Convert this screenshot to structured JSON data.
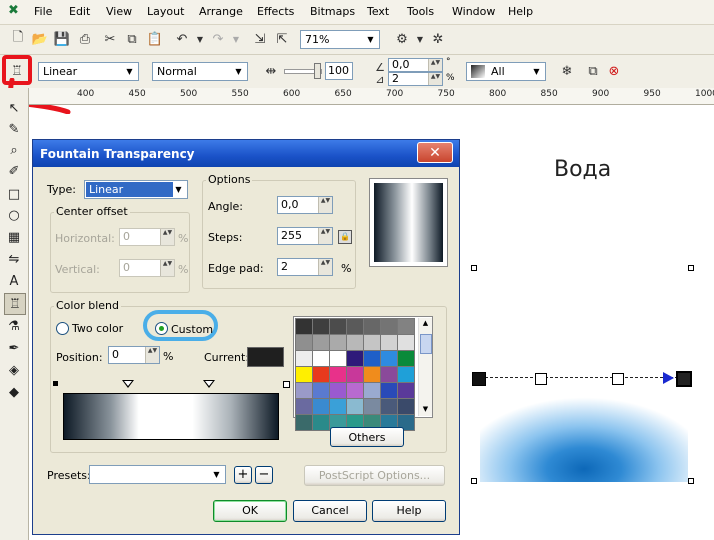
{
  "menu": {
    "items": [
      "File",
      "Edit",
      "View",
      "Layout",
      "Arrange",
      "Effects",
      "Bitmaps",
      "Text",
      "Tools",
      "Window",
      "Help"
    ],
    "logo_icon": "coreldraw-icon"
  },
  "toolbar_standard": {
    "zoom_value": "71%"
  },
  "property_bar": {
    "type_value": "Linear",
    "mode_value": "Normal",
    "midpoint_value": "100",
    "angle_value": "0,0",
    "edge_value": "2",
    "target_value": "All"
  },
  "ruler": {
    "ticks": [
      "400",
      "450",
      "500",
      "550",
      "600",
      "650",
      "700",
      "750",
      "800",
      "850",
      "900",
      "950",
      "1000"
    ]
  },
  "canvas": {
    "caption": "Вода"
  },
  "dialog": {
    "title": "Fountain Transparency",
    "close_label": "✕",
    "type_label": "Type:",
    "type_value": "Linear",
    "center_offset_label": "Center offset",
    "horizontal_label": "Horizontal:",
    "horizontal_value": "0",
    "vertical_label": "Vertical:",
    "vertical_value": "0",
    "pct": "%",
    "options_label": "Options",
    "angle_label": "Angle:",
    "angle_value": "0,0",
    "steps_label": "Steps:",
    "steps_value": "255",
    "edgepad_label": "Edge pad:",
    "edgepad_value": "2",
    "color_blend_label": "Color blend",
    "two_color_label": "Two color",
    "custom_label": "Custom",
    "position_label": "Position:",
    "position_value": "0",
    "current_label": "Current:",
    "others_label": "Others",
    "presets_label": "Presets:",
    "postscript_label": "PostScript Options...",
    "ok_label": "OK",
    "cancel_label": "Cancel",
    "help_label": "Help",
    "palette_colors": [
      "#333333",
      "#3f3f3f",
      "#4c4c4c",
      "#5a5a5a",
      "#676767",
      "#747474",
      "#828282",
      "#8f8f8f",
      "#9d9d9d",
      "#aaaaaa",
      "#b8b8b8",
      "#c5c5c5",
      "#d2d2d2",
      "#e0e0e0",
      "#ededed",
      "#ffffff",
      "#ffffff",
      "#2e1a7a",
      "#1f5fc8",
      "#2e8be0",
      "#0a8a3a",
      "#ffef00",
      "#e83a1d",
      "#e8318a",
      "#c8389a",
      "#f08c1c",
      "#8a4a9a",
      "#1fa0d8",
      "#9a9ac8",
      "#5a7ad0",
      "#9a5ad0",
      "#b86ad0",
      "#9aaad0",
      "#2a4ab8",
      "#5a3a9a",
      "#6a6aa0",
      "#3a8ad0",
      "#3aa0d8",
      "#8abad0",
      "#7a8aa0",
      "#4a5a7a",
      "#3a4a6a",
      "#3a6a6a",
      "#2a8a8a",
      "#3a9a9a",
      "#2a9a8a",
      "#3a8a7a",
      "#2a7a9a",
      "#2a6a8a"
    ]
  }
}
